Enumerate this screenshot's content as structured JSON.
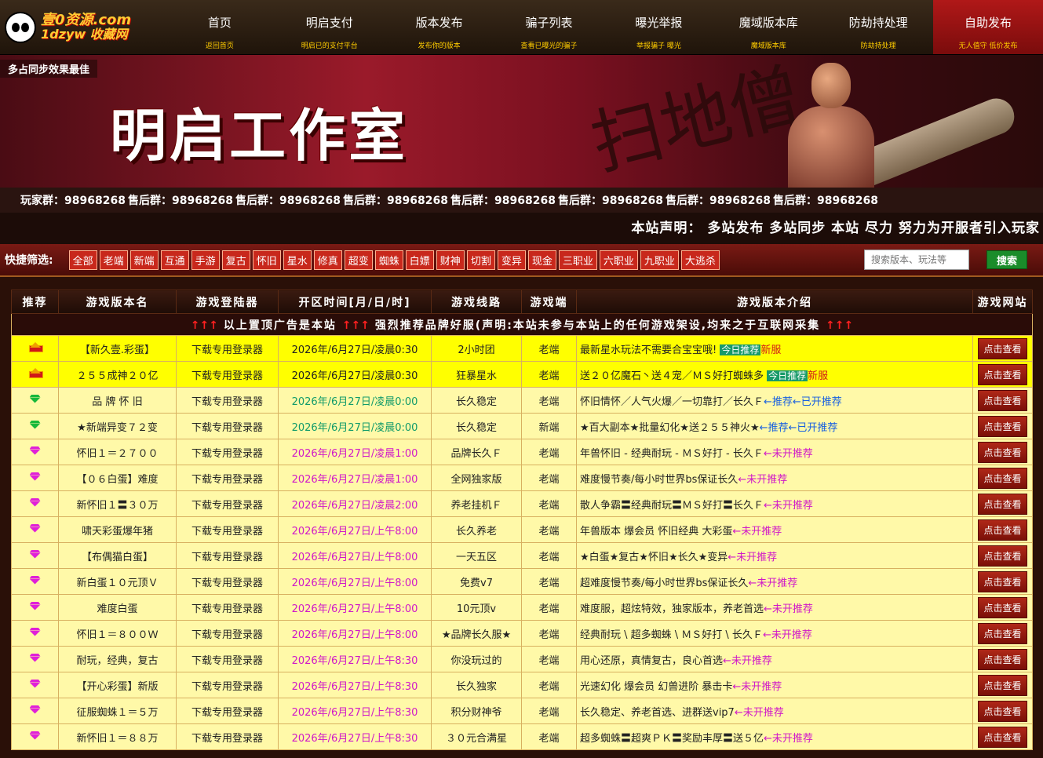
{
  "logo": {
    "line1": "壹0资源.com",
    "line2": "1dzyw 收藏网"
  },
  "nav": [
    {
      "title": "首页",
      "sub": "返回首页"
    },
    {
      "title": "明启支付",
      "sub": "明启已的支付平台"
    },
    {
      "title": "版本发布",
      "sub": "发布你的版本"
    },
    {
      "title": "骗子列表",
      "sub": "查看已曝光的骗子"
    },
    {
      "title": "曝光举报",
      "sub": "举报骗子 曝光"
    },
    {
      "title": "魔域版本库",
      "sub": "魔域版本库"
    },
    {
      "title": "防劫持处理",
      "sub": "防劫持处理"
    },
    {
      "title": "自助发布",
      "sub": "无人值守 低价发布"
    }
  ],
  "banner": {
    "tag": "多占同步效果最佳",
    "title": "明启工作室",
    "calligraphy": "扫地僧"
  },
  "qq": [
    "玩家群：98968268",
    "售后群：98968268",
    "售后群：98968268",
    "售后群：98968268",
    "售后群：98968268",
    "售后群：98968268",
    "售后群：98968268",
    "售后群：98968268"
  ],
  "statement": "本站声明： 多站发布 多站同步 本站 尽力 努力为开服者引入玩家",
  "filter": {
    "label": "快捷筛选:",
    "chips": [
      "全部",
      "老端",
      "新端",
      "互通",
      "手游",
      "复古",
      "怀旧",
      "星水",
      "修真",
      "超变",
      "蜘蛛",
      "白嫖",
      "财神",
      "切割",
      "变异",
      "现金",
      "三职业",
      "六职业",
      "九职业",
      "大逃杀"
    ],
    "search_placeholder": "搜索版本、玩法等",
    "search_button": "搜索"
  },
  "table": {
    "headers": [
      "推荐",
      "游戏版本名",
      "游戏登陆器",
      "开区时间[月/日/时]",
      "游戏线路",
      "游戏端",
      "游戏版本介绍",
      "游戏网站"
    ],
    "notice_arrows": "↑↑↑",
    "notice_text1": "以上置顶广告是本站",
    "notice_text2": "强烈推荐品牌好服(声明:本站未参与本站上的任何游戏架设,均来之于互联网采集",
    "launcher": "下载专用登录器",
    "view_label": "点击查看",
    "badge_today": "今日推荐",
    "badge_new": "新服",
    "rec_done": "←推荐←已开推荐",
    "rec_pending": "←未开推荐",
    "rows": [
      {
        "icon": "crown",
        "top": true,
        "name": "【新久壹.彩蛋】",
        "time": "2026年/6月27日/凌晨0:30",
        "tclass": "plain",
        "line": "2小时团",
        "client": "老端",
        "intro": "最新星水玩法不需要合宝宝哦!",
        "tail": "today"
      },
      {
        "icon": "crown",
        "top": true,
        "name": "２５５成神２０亿",
        "time": "2026年/6月27日/凌晨0:30",
        "tclass": "plain",
        "line": "狂暴星水",
        "client": "老端",
        "intro": "送２０亿魔石丶送４宠／ＭＳ好打蜘蛛多",
        "tail": "today"
      },
      {
        "icon": "gem-green",
        "top": false,
        "name": "品 牌 怀 旧",
        "time": "2026年/6月27日/凌晨0:00",
        "tclass": "green",
        "line": "长久稳定",
        "client": "老端",
        "intro": "怀旧情怀／人气火爆／一切靠打／长久Ｆ",
        "tail": "done"
      },
      {
        "icon": "gem-green",
        "top": false,
        "name": "★新端异变７２变",
        "time": "2026年/6月27日/凌晨0:00",
        "tclass": "green",
        "line": "长久稳定",
        "client": "新端",
        "intro": "★百大副本★批量幻化★送２５５神火★",
        "tail": "done"
      },
      {
        "icon": "gem-purple",
        "top": false,
        "name": "怀旧１＝２７００",
        "time": "2026年/6月27日/凌晨1:00",
        "tclass": "purple",
        "line": "品牌长久Ｆ",
        "client": "老端",
        "intro": "年兽怀旧 - 经典耐玩 - ＭＳ好打 - 长久Ｆ",
        "tail": "pending"
      },
      {
        "icon": "gem-purple",
        "top": false,
        "name": "【０６白蛋】难度",
        "time": "2026年/6月27日/凌晨1:00",
        "tclass": "purple",
        "line": "全网独家版",
        "client": "老端",
        "intro": "难度慢节奏/每小时世界bs保证长久",
        "tail": "pending"
      },
      {
        "icon": "gem-purple",
        "top": false,
        "name": "新怀旧１〓３０万",
        "time": "2026年/6月27日/凌晨2:00",
        "tclass": "purple",
        "line": "养老挂机Ｆ",
        "client": "老端",
        "intro": "散人争霸〓经典耐玩〓ＭＳ好打〓长久Ｆ",
        "tail": "pending"
      },
      {
        "icon": "gem-purple",
        "top": false,
        "name": "啸天彩蛋爆年猪",
        "time": "2026年/6月27日/上午8:00",
        "tclass": "purple",
        "line": "长久养老",
        "client": "老端",
        "intro": "年兽版本 爆会员 怀旧经典 大彩蛋",
        "tail": "pending"
      },
      {
        "icon": "gem-purple",
        "top": false,
        "name": "【布偶猫白蛋】",
        "time": "2026年/6月27日/上午8:00",
        "tclass": "purple",
        "line": "一天五区",
        "client": "老端",
        "intro": "★白蛋★复古★怀旧★长久★变异",
        "tail": "pending"
      },
      {
        "icon": "gem-purple",
        "top": false,
        "name": "新白蛋１０元顶Ｖ",
        "time": "2026年/6月27日/上午8:00",
        "tclass": "purple",
        "line": "免费v7",
        "client": "老端",
        "intro": "超难度慢节奏/每小时世界bs保证长久",
        "tail": "pending"
      },
      {
        "icon": "gem-purple",
        "top": false,
        "name": "难度白蛋",
        "time": "2026年/6月27日/上午8:00",
        "tclass": "purple",
        "line": "10元顶v",
        "client": "老端",
        "intro": "难度服，超炫特效，独家版本，养老首选",
        "tail": "pending"
      },
      {
        "icon": "gem-purple",
        "top": false,
        "name": "怀旧１＝８００Ｗ",
        "time": "2026年/6月27日/上午8:00",
        "tclass": "purple",
        "line": "★品牌长久服★",
        "client": "老端",
        "intro": "经典耐玩 \\ 超多蜘蛛 \\ ＭＳ好打 \\ 长久Ｆ",
        "tail": "pending"
      },
      {
        "icon": "gem-purple",
        "top": false,
        "name": "耐玩，经典，复古",
        "time": "2026年/6月27日/上午8:30",
        "tclass": "purple",
        "line": "你没玩过的",
        "client": "老端",
        "intro": "用心还原，真情复古，良心首选",
        "tail": "pending"
      },
      {
        "icon": "gem-purple",
        "top": false,
        "name": "【开心彩蛋】新版",
        "time": "2026年/6月27日/上午8:30",
        "tclass": "purple",
        "line": "长久独家",
        "client": "老端",
        "intro": "光速幻化 爆会员 幻兽进阶 暴击卡",
        "tail": "pending"
      },
      {
        "icon": "gem-purple",
        "top": false,
        "name": "征服蜘蛛１＝５万",
        "time": "2026年/6月27日/上午8:30",
        "tclass": "purple",
        "line": "积分财神爷",
        "client": "老端",
        "intro": "长久稳定、养老首选、进群送vip7",
        "tail": "pending"
      },
      {
        "icon": "gem-purple",
        "top": false,
        "name": "新怀旧１＝８８万",
        "time": "2026年/6月27日/上午8:30",
        "tclass": "purple",
        "line": "３０元合满星",
        "client": "老端",
        "intro": "超多蜘蛛〓超爽ＰＫ〓奖励丰厚〓送５亿",
        "tail": "pending"
      }
    ]
  },
  "colors": {
    "gem_green": "#18b83a",
    "gem_purple": "#e020d8",
    "accent_red": "#c8281c"
  }
}
